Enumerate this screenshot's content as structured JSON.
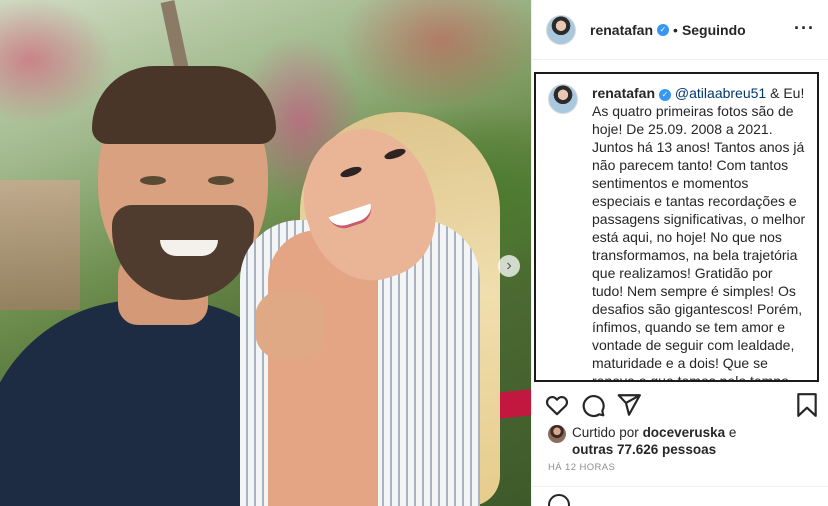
{
  "header": {
    "username": "renatafan",
    "separator": "•",
    "follow_status": "Seguindo",
    "more_icon": "more-horizontal-icon",
    "verified_icon": "verified-badge-icon"
  },
  "caption": {
    "username": "renatafan",
    "mention": "@atilaabreu51",
    "text": "& Eu! As quatro primeiras fotos são de hoje! De 25.09. 2008 a 2021. Juntos há 13 anos! Tantos anos já não parecem tanto! Com tantos sentimentos e momentos especiais e tantas recordações e passagens significativas, o melhor está aqui, no hoje! No que nos transformamos, na bela trajetória que realizamos! Gratidão por tudo! Nem sempre é simples! Os desafios são gigantescos! Porém, ínfimos, quando se tem amor e vontade de seguir com lealdade, maturidade e a dois! Que se renove o que temos pelo tempo que a felicidade quiser! Que vc continue me fazendo bem e confiante! Amor de verdade é o que sinto por vc! Com 13 anos de atestado de excelente saúde"
  },
  "actions": {
    "like_icon": "heart-icon",
    "comment_icon": "comment-icon",
    "share_icon": "send-icon",
    "save_icon": "bookmark-icon"
  },
  "likes": {
    "prefix": "Curtido por",
    "liker": "doceveruska",
    "conj": "e",
    "others": "outras 77.626 pessoas"
  },
  "timestamp": "HÁ 12 HORAS",
  "photo": {
    "next_icon": "chevron-right-icon"
  }
}
